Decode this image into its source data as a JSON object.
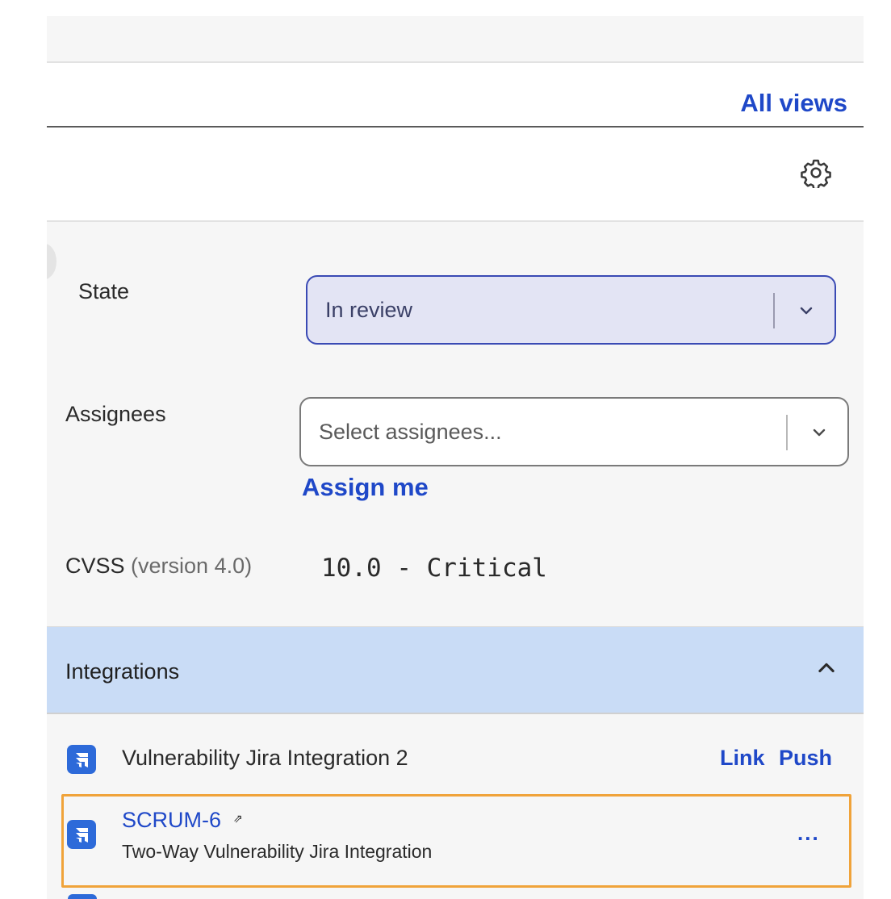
{
  "header": {
    "all_views_label": "All views"
  },
  "settings": {
    "icon": "gear-icon"
  },
  "fields": {
    "state_label": "State",
    "state_value": "In review",
    "assignees_label": "Assignees",
    "assignees_placeholder": "Select assignees...",
    "assign_me_label": "Assign me",
    "cvss_label": "CVSS",
    "cvss_version": "(version 4.0)",
    "cvss_value": "10.0 - Critical"
  },
  "integrations": {
    "title": "Integrations",
    "items": [
      {
        "name": "Vulnerability Jira Integration 2",
        "icon": "jira-icon",
        "link_label": "Link",
        "push_label": "Push"
      }
    ],
    "linked_issue": {
      "key": "SCRUM-6",
      "external_glyph": "⇗",
      "integration": "Two-Way Vulnerability Jira Integration",
      "more_label": "..."
    }
  },
  "colors": {
    "accent": "#1f48c8",
    "integrations_header_bg": "#c9dcf6",
    "state_select_bg": "#e3e4f4",
    "highlight_border": "#f0a33a",
    "jira_blue": "#2d6ad9"
  }
}
